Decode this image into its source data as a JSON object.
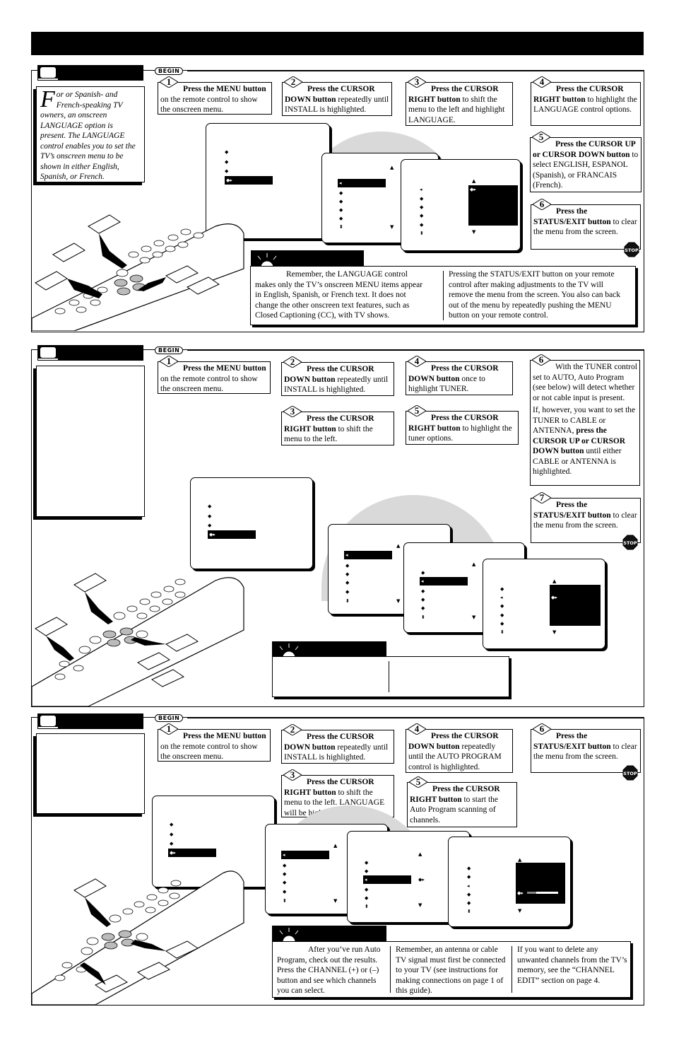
{
  "page": {
    "header_bar": ""
  },
  "begin_label": "BEGIN",
  "stop_label": "STOP",
  "sections": [
    {
      "id": "language",
      "intro": {
        "drop_cap": "F",
        "text": "or or Spanish- and French-speaking TV owners, an onscreen LANGUAGE option is present. The LANGUAGE control enables you to set the TV’s onscreen menu to be shown in either English, Spanish, or French."
      },
      "steps": [
        {
          "num": "1",
          "bold": "Press the MENU button",
          "text": " on the remote control to show the onscreen menu."
        },
        {
          "num": "2",
          "bold": "Press the CURSOR DOWN button",
          "text": " repeatedly until INSTALL is highlighted."
        },
        {
          "num": "3",
          "bold": "Press the CURSOR RIGHT button",
          "text": " to shift the menu to the left and highlight LANGUAGE."
        },
        {
          "num": "4",
          "bold": "Press the CURSOR RIGHT button",
          "text": " to highlight the LANGUAGE control options."
        },
        {
          "num": "5",
          "bold": "Press the CURSOR UP or CURSOR DOWN button",
          "text": " to select ENGLISH, ESPANOL (Spanish), or FRANCAIS (French)."
        },
        {
          "num": "6",
          "bold": "Press the STATUS/EXIT button",
          "text": " to clear the menu from the screen."
        }
      ],
      "tips": [
        "Remember, the LANGUAGE control makes only the TV’s onscreen MENU items appear in English, Spanish, or French text. It does not change the other onscreen text features, such as Closed Captioning (CC), with TV shows.",
        "Pressing the STATUS/EXIT button on your remote control after making adjustments to the TV will remove the menu from the screen. You also can back out of the menu by repeatedly pushing the MENU button on your remote control."
      ]
    },
    {
      "id": "tuner",
      "steps": [
        {
          "num": "1",
          "bold": "Press the MENU button",
          "text": " on the remote control to show the onscreen menu."
        },
        {
          "num": "2",
          "bold": "Press the CURSOR DOWN button",
          "text": " repeatedly until INSTALL is highlighted."
        },
        {
          "num": "3",
          "bold": "Press the CURSOR RIGHT button",
          "text": " to shift the menu to the left."
        },
        {
          "num": "4",
          "bold": "Press the CURSOR DOWN button",
          "text": " once to highlight TUNER."
        },
        {
          "num": "5",
          "bold": "Press the CURSOR RIGHT button",
          "text": " to highlight the tuner options."
        },
        {
          "num": "6",
          "text_a": "With the TUNER control set to AUTO, Auto Program (see below) will detect whether or not cable input is present.",
          "text_b": "If, however, you want to set the TUNER to CABLE or ANTENNA, ",
          "bold_b": "press the CURSOR UP or CURSOR DOWN button",
          "text_c": " until either CABLE or ANTENNA is highlighted."
        },
        {
          "num": "7",
          "bold": "Press the STATUS/EXIT button",
          "text": " to clear the menu from the screen."
        }
      ]
    },
    {
      "id": "auto-program",
      "steps": [
        {
          "num": "1",
          "bold": "Press the MENU button",
          "text": " on the remote control to show the onscreen menu."
        },
        {
          "num": "2",
          "bold": "Press the CURSOR DOWN button",
          "text": " repeatedly until INSTALL is highlighted."
        },
        {
          "num": "3",
          "bold": "Press the CURSOR RIGHT button",
          "text": " to shift the menu to the left. LANGUAGE will be highlighted."
        },
        {
          "num": "4",
          "bold": "Press the CURSOR DOWN button",
          "text": " repeatedly until the AUTO PROGRAM control is highlighted."
        },
        {
          "num": "5",
          "bold": "Press the CURSOR RIGHT button",
          "text": " to start the Auto Program scanning of channels."
        },
        {
          "num": "6",
          "bold": "Press the STATUS/EXIT button",
          "text": " to clear the menu from the screen."
        }
      ],
      "tips": [
        "After you’ve run Auto Program, check out the results. Press the CHANNEL (+) or (–) button and see which channels you can select.",
        "Remember, an antenna or cable TV signal must first be connected to your TV (see instructions for making connections on page 1 of this guide).",
        "If you want to delete any unwanted channels from the TV’s memory, see the “CHANNEL EDIT” section on page 4."
      ],
      "scan_progress": 0.3
    }
  ],
  "menu_glyphs": {
    "bullet": "◆",
    "left": "◂",
    "both": "◆▸",
    "up": "▲",
    "down": "▼",
    "updown": "⬍"
  }
}
